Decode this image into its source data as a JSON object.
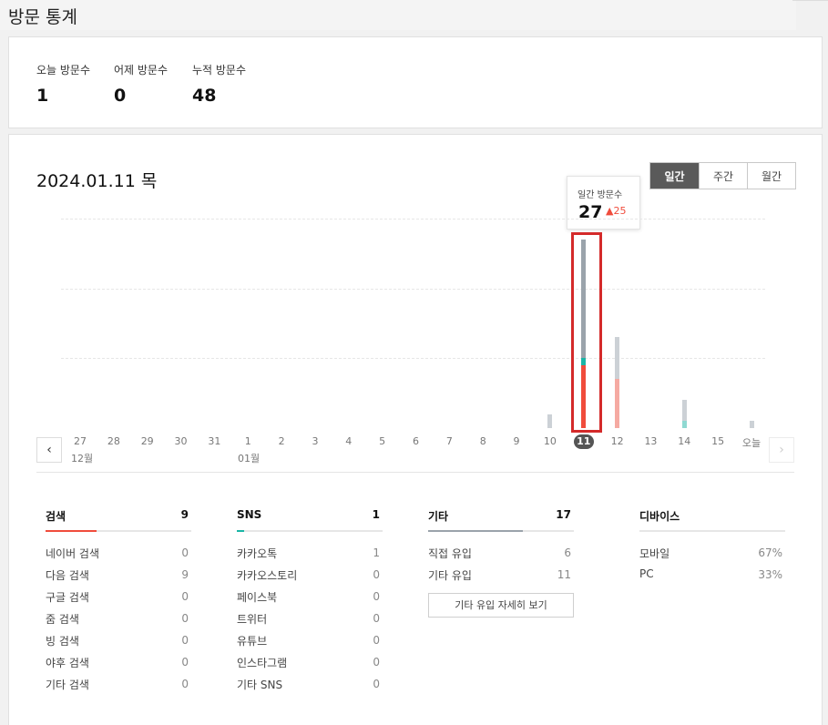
{
  "page_title": "방문 통계",
  "summary": [
    {
      "label": "오늘 방문수",
      "value": "1"
    },
    {
      "label": "어제 방문수",
      "value": "0"
    },
    {
      "label": "누적 방문수",
      "value": "48"
    }
  ],
  "selected_date": "2024.01.11 목",
  "period_tabs": [
    {
      "label": "일간",
      "active": true
    },
    {
      "label": "주간",
      "active": false
    },
    {
      "label": "월간",
      "active": false
    }
  ],
  "tooltip": {
    "label": "일간 방문수",
    "value": "27",
    "delta": "25"
  },
  "x_labels": [
    "27",
    "28",
    "29",
    "30",
    "31",
    "1",
    "2",
    "3",
    "4",
    "5",
    "6",
    "7",
    "8",
    "9",
    "10",
    "11",
    "12",
    "13",
    "14",
    "15",
    "오늘"
  ],
  "month_labels": [
    "12월",
    "01월"
  ],
  "nav": {
    "prev": "‹",
    "next": "›"
  },
  "colors": {
    "search": "#f04c3c",
    "sns": "#1ab5a6",
    "other": "#9aa3ab",
    "search_light": "#f5aaa2",
    "other_light": "#ccd1d6",
    "sns_light": "#8fd9d2"
  },
  "chart_data": {
    "type": "bar",
    "stacked": true,
    "categories": [
      "27",
      "28",
      "29",
      "30",
      "31",
      "1",
      "2",
      "3",
      "4",
      "5",
      "6",
      "7",
      "8",
      "9",
      "10",
      "11",
      "12",
      "13",
      "14",
      "15",
      "오늘"
    ],
    "series": [
      {
        "values": [
          0,
          0,
          0,
          0,
          0,
          0,
          0,
          0,
          0,
          0,
          0,
          0,
          0,
          0,
          0,
          9,
          7,
          0,
          0,
          0,
          0
        ]
      },
      {
        "values": [
          0,
          0,
          0,
          0,
          0,
          0,
          0,
          0,
          0,
          0,
          0,
          0,
          0,
          0,
          0,
          1,
          0,
          0,
          1,
          0,
          0
        ]
      },
      {
        "values": [
          0,
          0,
          0,
          0,
          0,
          0,
          0,
          0,
          0,
          0,
          0,
          0,
          0,
          0,
          2,
          17,
          6,
          0,
          3,
          0,
          1
        ]
      }
    ],
    "ylim": [
      0,
      30
    ],
    "grid": true
  },
  "sources": {
    "search": {
      "title": "검색",
      "count": "9",
      "fill_fraction": 0.35,
      "rows": [
        {
          "label": "네이버 검색",
          "value": "0"
        },
        {
          "label": "다음 검색",
          "value": "9"
        },
        {
          "label": "구글 검색",
          "value": "0"
        },
        {
          "label": "줌 검색",
          "value": "0"
        },
        {
          "label": "빙 검색",
          "value": "0"
        },
        {
          "label": "야후 검색",
          "value": "0"
        },
        {
          "label": "기타 검색",
          "value": "0"
        }
      ]
    },
    "sns": {
      "title": "SNS",
      "count": "1",
      "fill_fraction": 0.05,
      "rows": [
        {
          "label": "카카오톡",
          "value": "1"
        },
        {
          "label": "카카오스토리",
          "value": "0"
        },
        {
          "label": "페이스북",
          "value": "0"
        },
        {
          "label": "트위터",
          "value": "0"
        },
        {
          "label": "유튜브",
          "value": "0"
        },
        {
          "label": "인스타그램",
          "value": "0"
        },
        {
          "label": "기타 SNS",
          "value": "0"
        }
      ]
    },
    "other": {
      "title": "기타",
      "count": "17",
      "fill_fraction": 0.65,
      "rows": [
        {
          "label": "직접 유입",
          "value": "6"
        },
        {
          "label": "기타 유입",
          "value": "11"
        }
      ],
      "detail_button": "기타 유입 자세히 보기"
    },
    "device": {
      "title": "디바이스",
      "rows": [
        {
          "label": "모바일",
          "value": "67%"
        },
        {
          "label": "PC",
          "value": "33%"
        }
      ]
    }
  }
}
